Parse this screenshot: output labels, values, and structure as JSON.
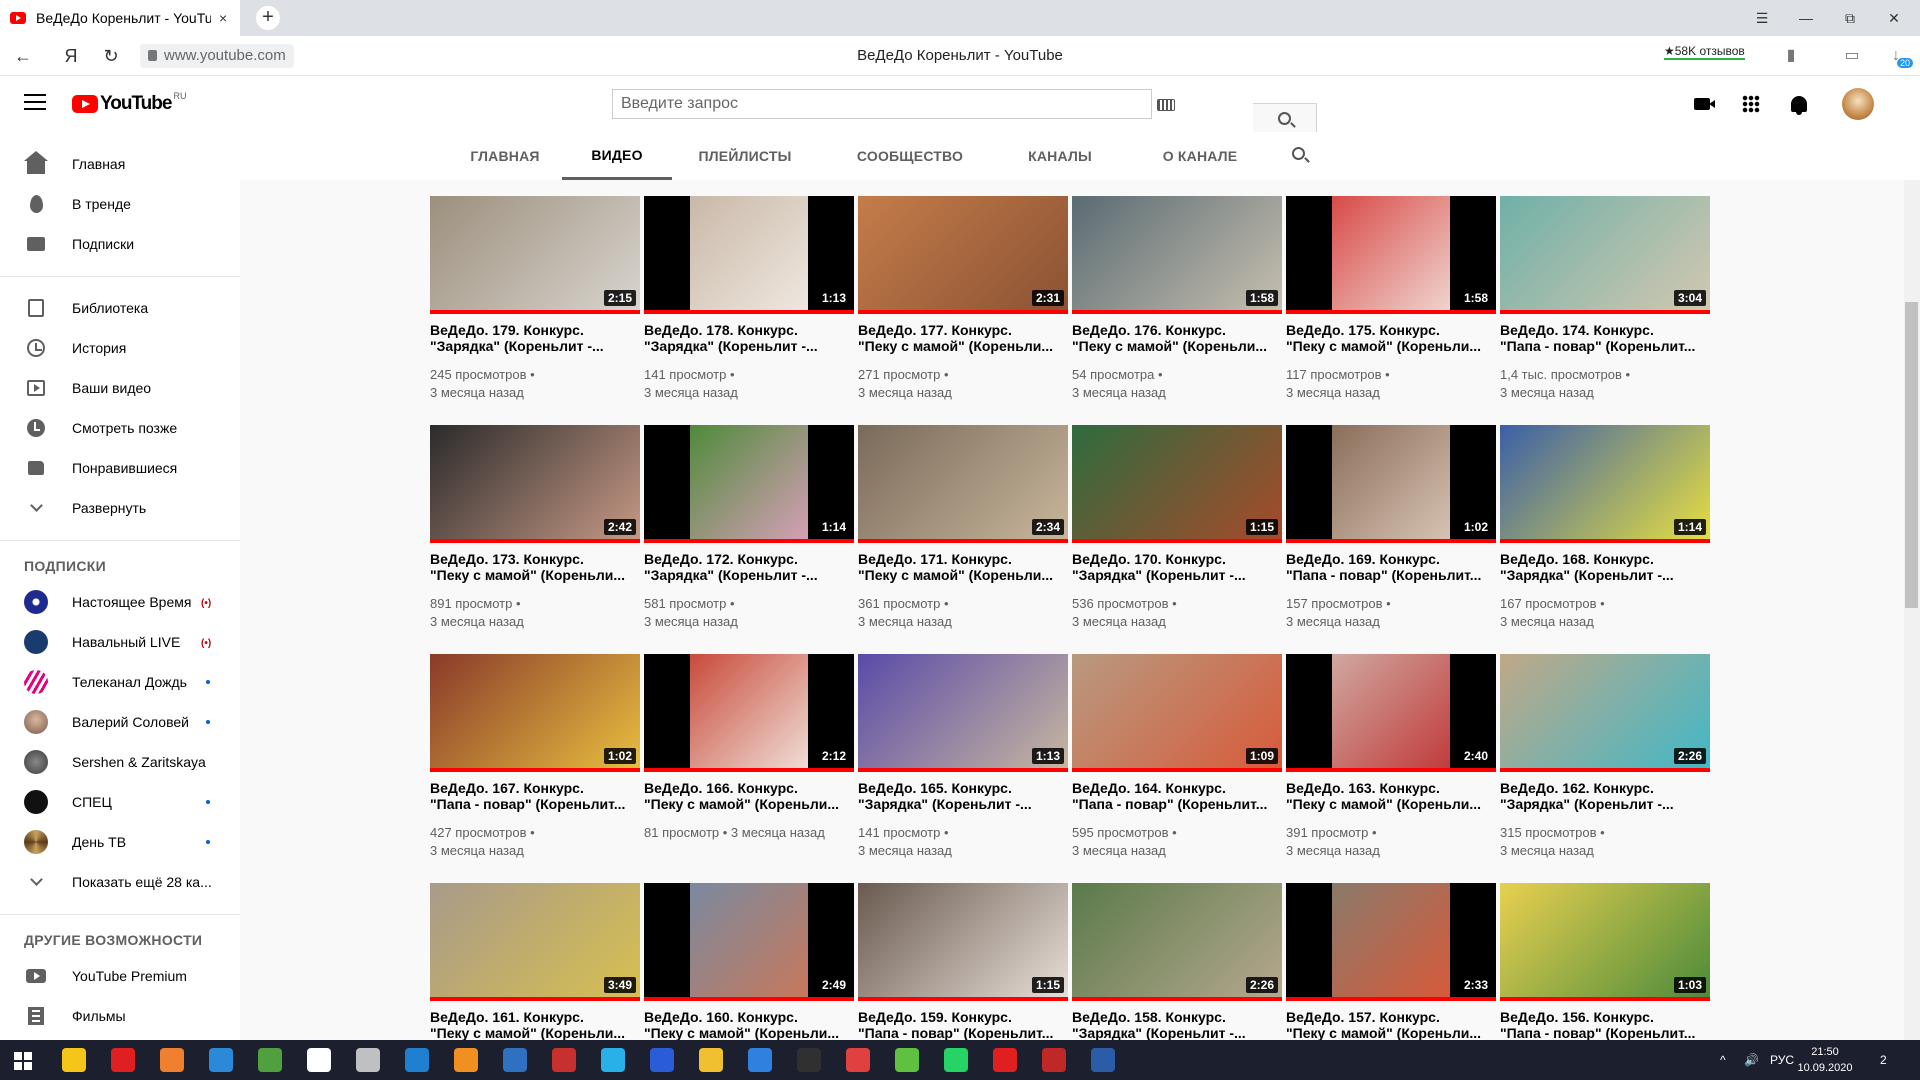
{
  "browser": {
    "tab_title": "ВеДеДо Кореньлит - YouTube",
    "tab_close": "×",
    "new_tab": "+",
    "back": "←",
    "ya": "Я",
    "reload": "↻",
    "url": "www.youtube.com",
    "page_heading": "ВеДеДо Кореньлит - YouTube",
    "reviews": "★58K отзывов",
    "downloads_badge": "20",
    "win_menu": "☰",
    "win_min": "—",
    "win_max": "⧉",
    "win_close": "✕"
  },
  "masthead": {
    "logo_text": "YouTube",
    "logo_region": "RU",
    "search_placeholder": "Введите запрос"
  },
  "sidebar": {
    "main": [
      {
        "label": "Главная",
        "icon": "home-icon"
      },
      {
        "label": "В тренде",
        "icon": "trending-icon"
      },
      {
        "label": "Подписки",
        "icon": "subscriptions-icon"
      }
    ],
    "library": [
      {
        "label": "Библиотека",
        "icon": "library-icon"
      },
      {
        "label": "История",
        "icon": "history-icon"
      },
      {
        "label": "Ваши видео",
        "icon": "your-videos-icon"
      },
      {
        "label": "Смотреть позже",
        "icon": "watch-later-icon"
      },
      {
        "label": "Понравившиеся",
        "icon": "liked-icon"
      },
      {
        "label": "Развернуть",
        "icon": "chevron-down-icon"
      }
    ],
    "subs_heading": "ПОДПИСКИ",
    "subscriptions": [
      {
        "label": "Настоящее Время",
        "status": "(•)",
        "color": "#1e2a8f"
      },
      {
        "label": "Навальный LIVE",
        "status": "(•)",
        "color": "#1a3b6e"
      },
      {
        "label": "Телеканал Дождь",
        "status": "dot",
        "color": "#e6007e"
      },
      {
        "label": "Валерий Соловей",
        "status": "dot",
        "color": "#7a5a48"
      },
      {
        "label": "Sershen & Zaritskaya",
        "status": "",
        "color": "#3b3b3b"
      },
      {
        "label": "СПЕЦ",
        "status": "dot",
        "color": "#111111"
      },
      {
        "label": "День ТВ",
        "status": "dot",
        "color": "#c8a25b"
      }
    ],
    "show_more": "Показать ещё 28 ка...",
    "other_heading": "ДРУГИЕ ВОЗМОЖНОСТИ",
    "other": [
      {
        "label": "YouTube Premium",
        "icon": "youtube-premium-icon"
      },
      {
        "label": "Фильмы",
        "icon": "movies-icon"
      }
    ]
  },
  "tabs": [
    "ГЛАВНАЯ",
    "ВИДЕО",
    "ПЛЕЙЛИСТЫ",
    "СООБЩЕСТВО",
    "КАНАЛЫ",
    "О КАНАЛЕ"
  ],
  "active_tab": "ВИДЕО",
  "videos": [
    {
      "t1": "ВеДеДо. 179. Конкурс.",
      "t2": "\"Зарядка\" (Кореньлит -...",
      "views": "245 просмотров •",
      "age": "3 месяца назад",
      "duration": "2:15",
      "thumb": [
        "#9c8f7d",
        "#d9d5cf"
      ]
    },
    {
      "t1": "ВеДеДо. 178. Конкурс.",
      "t2": "\"Зарядка\" (Кореньлит -...",
      "views": "141 просмотр •",
      "age": "3 месяца назад",
      "duration": "1:13",
      "thumb": [
        "#c9b8a8",
        "#efe8e0"
      ]
    },
    {
      "t1": "ВеДеДо. 177. Конкурс.",
      "t2": "\"Пеку с мамой\" (Кореньли...",
      "views": "271 просмотр •",
      "age": "3 месяца назад",
      "duration": "2:31",
      "thumb": [
        "#c57c4a",
        "#8a5233"
      ]
    },
    {
      "t1": "ВеДеДо. 176. Конкурс.",
      "t2": "\"Пеку с мамой\" (Кореньли...",
      "views": "54 просмотра •",
      "age": "3 месяца назад",
      "duration": "1:58",
      "thumb": [
        "#5a6b73",
        "#c8c0b0"
      ]
    },
    {
      "t1": "ВеДеДо. 175. Конкурс.",
      "t2": "\"Пеку с мамой\" (Кореньли...",
      "views": "117 просмотров •",
      "age": "3 месяца назад",
      "duration": "1:58",
      "thumb": [
        "#d84a48",
        "#f0d6d0"
      ]
    },
    {
      "t1": "ВеДеДо. 174. Конкурс.",
      "t2": "\"Папа - повар\" (Кореньлит...",
      "views": "1,4 тыс. просмотров •",
      "age": "3 месяца назад",
      "duration": "3:04",
      "thumb": [
        "#6fb0a8",
        "#d4c8b0"
      ]
    },
    {
      "t1": "ВеДеДо. 173. Конкурс.",
      "t2": "\"Пеку с мамой\" (Кореньли...",
      "views": "891 просмотр •",
      "age": "3 месяца назад",
      "duration": "2:42",
      "thumb": [
        "#2b2b2b",
        "#c89a86"
      ]
    },
    {
      "t1": "ВеДеДо. 172. Конкурс.",
      "t2": "\"Зарядка\" (Кореньлит -...",
      "views": "581 просмотр •",
      "age": "3 месяца назад",
      "duration": "1:14",
      "thumb": [
        "#4f8a3a",
        "#d7a0b8"
      ]
    },
    {
      "t1": "ВеДеДо. 171. Конкурс.",
      "t2": "\"Пеку с мамой\" (Кореньли...",
      "views": "361 просмотр •",
      "age": "3 месяца назад",
      "duration": "2:34",
      "thumb": [
        "#7a6a5a",
        "#c9b79c"
      ]
    },
    {
      "t1": "ВеДеДо. 170. Конкурс.",
      "t2": "\"Зарядка\" (Кореньлит -...",
      "views": "536 просмотров •",
      "age": "3 месяца назад",
      "duration": "1:15",
      "thumb": [
        "#2f6b3f",
        "#a84a2a"
      ]
    },
    {
      "t1": "ВеДеДо. 169. Конкурс.",
      "t2": "\"Папа - повар\" (Кореньлит...",
      "views": "157 просмотров •",
      "age": "3 месяца назад",
      "duration": "1:02",
      "thumb": [
        "#8a6e5a",
        "#d8c4b4"
      ]
    },
    {
      "t1": "ВеДеДо. 168. Конкурс.",
      "t2": "\"Зарядка\" (Кореньлит -...",
      "views": "167 просмотров •",
      "age": "3 месяца назад",
      "duration": "1:14",
      "thumb": [
        "#3a5fa8",
        "#e8e040"
      ]
    },
    {
      "t1": "ВеДеДо. 167. Конкурс.",
      "t2": "\"Папа - повар\" (Кореньлит...",
      "views": "427 просмотров •",
      "age": "3 месяца назад",
      "duration": "1:02",
      "thumb": [
        "#8a3a2a",
        "#e8c040"
      ]
    },
    {
      "t1": "ВеДеДо. 166. Конкурс.",
      "t2": "\"Пеку с мамой\" (Кореньли...",
      "views": "81 просмотр • 3 месяца назад",
      "age": "",
      "duration": "2:12",
      "thumb": [
        "#c84a3a",
        "#f0e0d8"
      ]
    },
    {
      "t1": "ВеДеДо. 165. Конкурс.",
      "t2": "\"Зарядка\" (Кореньлит -...",
      "views": "141 просмотр •",
      "age": "3 месяца назад",
      "duration": "1:13",
      "thumb": [
        "#5a4aa8",
        "#c8b8a0"
      ]
    },
    {
      "t1": "ВеДеДо. 164. Конкурс.",
      "t2": "\"Папа - повар\" (Кореньлит...",
      "views": "595 просмотров •",
      "age": "3 месяца назад",
      "duration": "1:09",
      "thumb": [
        "#b89a80",
        "#d85a3a"
      ]
    },
    {
      "t1": "ВеДеДо. 163. Конкурс.",
      "t2": "\"Пеку с мамой\" (Кореньли...",
      "views": "391 просмотр •",
      "age": "3 месяца назад",
      "duration": "2:40",
      "thumb": [
        "#d0a8a0",
        "#c03a3a"
      ]
    },
    {
      "t1": "ВеДеДо. 162. Конкурс.",
      "t2": "\"Зарядка\" (Кореньлит -...",
      "views": "315 просмотров •",
      "age": "3 месяца назад",
      "duration": "2:26",
      "thumb": [
        "#c0a888",
        "#40b8c8"
      ]
    },
    {
      "t1": "ВеДеДо. 161. Конкурс.",
      "t2": "\"Пеку с мамой\" (Кореньли...",
      "views": "",
      "age": "",
      "duration": "3:49",
      "thumb": [
        "#a89a8a",
        "#d8c050"
      ]
    },
    {
      "t1": "ВеДеДо. 160. Конкурс.",
      "t2": "\"Пеку с мамой\" (Кореньли...",
      "views": "",
      "age": "",
      "duration": "2:49",
      "thumb": [
        "#7a8aa0",
        "#c8785a"
      ]
    },
    {
      "t1": "ВеДеДо. 159. Конкурс.",
      "t2": "\"Папа - повар\" (Кореньлит...",
      "views": "",
      "age": "",
      "duration": "1:15",
      "thumb": [
        "#6a5a50",
        "#e8e0d8"
      ]
    },
    {
      "t1": "ВеДеДо. 158. Конкурс.",
      "t2": "\"Зарядка\" (Кореньлит -...",
      "views": "",
      "age": "",
      "duration": "2:26",
      "thumb": [
        "#5a7a4a",
        "#b8a890"
      ]
    },
    {
      "t1": "ВеДеДо. 157. Конкурс.",
      "t2": "\"Пеку с мамой\" (Кореньли...",
      "views": "",
      "age": "",
      "duration": "2:33",
      "thumb": [
        "#8a7a6a",
        "#d85a3a"
      ]
    },
    {
      "t1": "ВеДеДо. 156. Конкурс.",
      "t2": "\"Папа - повар\" (Кореньлит...",
      "views": "",
      "age": "",
      "duration": "1:03",
      "thumb": [
        "#e8d050",
        "#4a8a3a"
      ]
    }
  ],
  "colors": {
    "youtube_red": "#ff0000",
    "progress": "#ff0000",
    "text_primary": "#030303",
    "text_secondary": "#606060",
    "taskbar": "#1c1f2e"
  },
  "taskbar": {
    "apps": [
      "#f5c518",
      "#e02020",
      "#f08030",
      "#2a8ad8",
      "#50a040",
      "#ffffff",
      "#c0c0c0",
      "#2080d0",
      "#f09020",
      "#3070c0",
      "#c83030",
      "#2ab0e8",
      "#2a5cd8",
      "#f0c030",
      "#3080e0",
      "#303030",
      "#e04040",
      "#60c040",
      "#25d366",
      "#e02020",
      "#c02828",
      "#2a5ca8"
    ],
    "tray_arrow": "^",
    "tray_volume": "🔊",
    "language": "РУС",
    "time": "21:50",
    "date": "10.09.2020",
    "notifications": "2"
  }
}
